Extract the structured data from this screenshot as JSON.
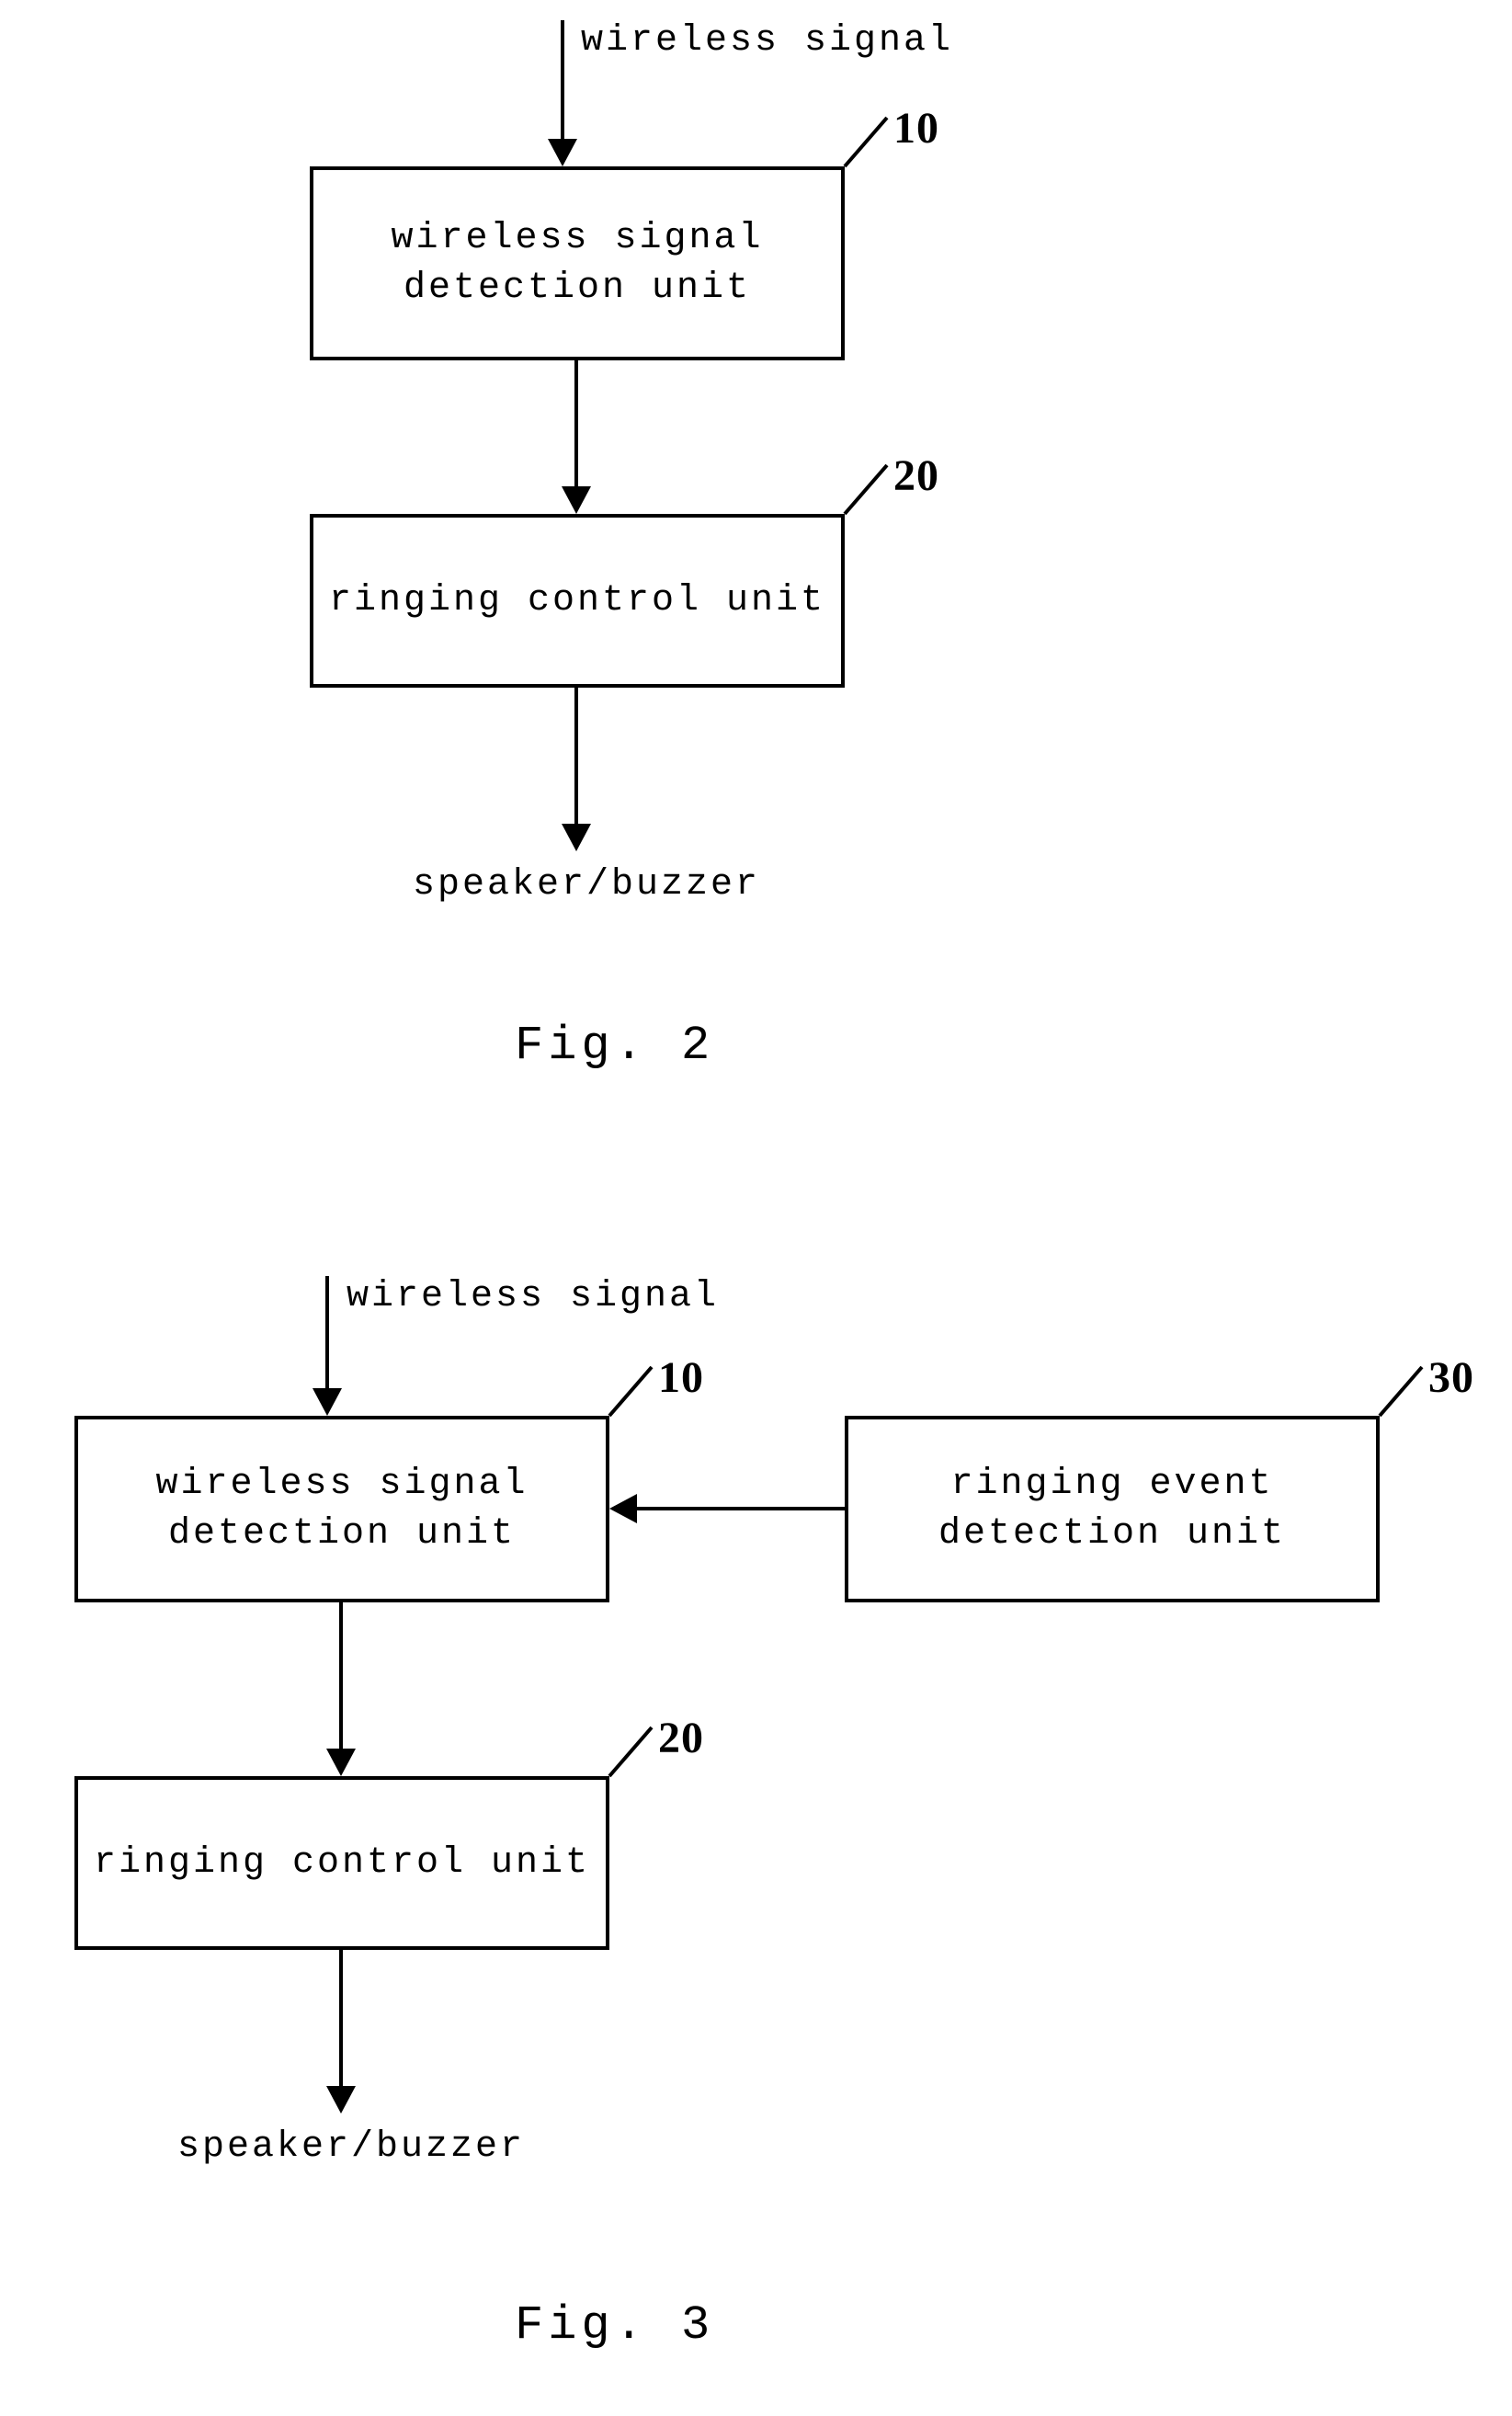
{
  "fig2": {
    "input_label": "wireless signal",
    "box10": {
      "ref": "10",
      "text": "wireless signal\ndetection unit"
    },
    "box20": {
      "ref": "20",
      "text": "ringing control unit"
    },
    "output_label": "speaker/buzzer",
    "caption": "Fig. 2"
  },
  "fig3": {
    "input_label": "wireless signal",
    "box10": {
      "ref": "10",
      "text": "wireless signal\ndetection unit"
    },
    "box20": {
      "ref": "20",
      "text": "ringing control unit"
    },
    "box30": {
      "ref": "30",
      "text": "ringing event\ndetection unit"
    },
    "output_label": "speaker/buzzer",
    "caption": "Fig. 3"
  }
}
